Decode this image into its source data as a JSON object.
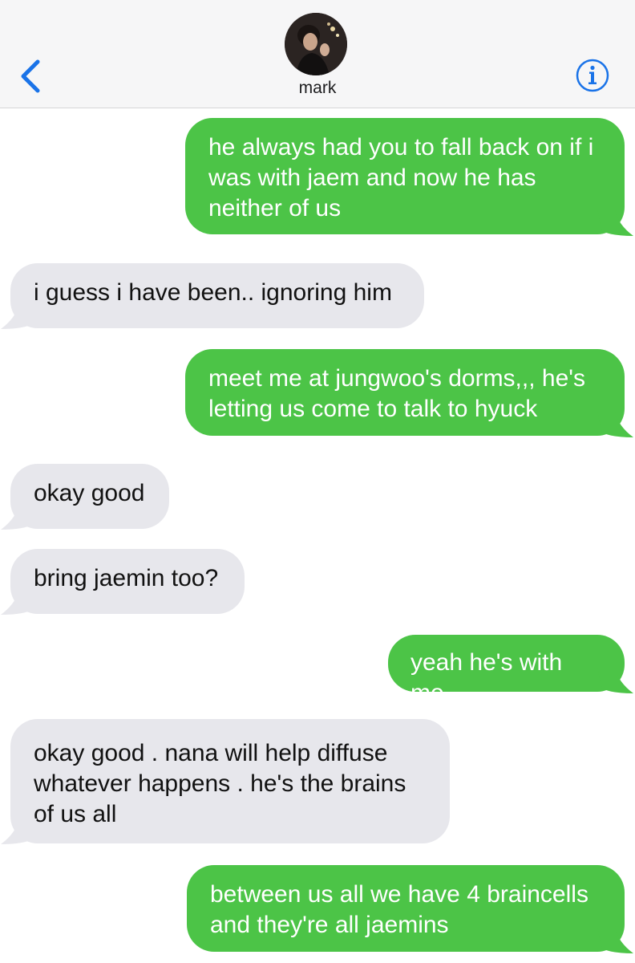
{
  "header": {
    "contact_name": "mark",
    "back_icon": "chevron-left-icon",
    "info_icon": "info-circle-icon",
    "accent_color": "#1a73e8"
  },
  "colors": {
    "outgoing_bubble": "#4cc447",
    "incoming_bubble": "#e7e7ec"
  },
  "messages": [
    {
      "direction": "outgoing",
      "text": "he always had you to fall back on if i was with jaem and now he has neither of us"
    },
    {
      "direction": "incoming",
      "text": "i guess i have been.. ignoring him"
    },
    {
      "direction": "outgoing",
      "text": "meet me at jungwoo's dorms,,, he's letting us come to talk to hyuck"
    },
    {
      "direction": "incoming",
      "text": "okay good"
    },
    {
      "direction": "incoming",
      "text": "bring jaemin too?"
    },
    {
      "direction": "outgoing",
      "text": "yeah he's with me"
    },
    {
      "direction": "incoming",
      "text": "okay good . nana will help diffuse whatever happens . he's the brains of us all"
    },
    {
      "direction": "outgoing",
      "text": "between us all we have 4 braincells and they're all jaemins"
    }
  ]
}
